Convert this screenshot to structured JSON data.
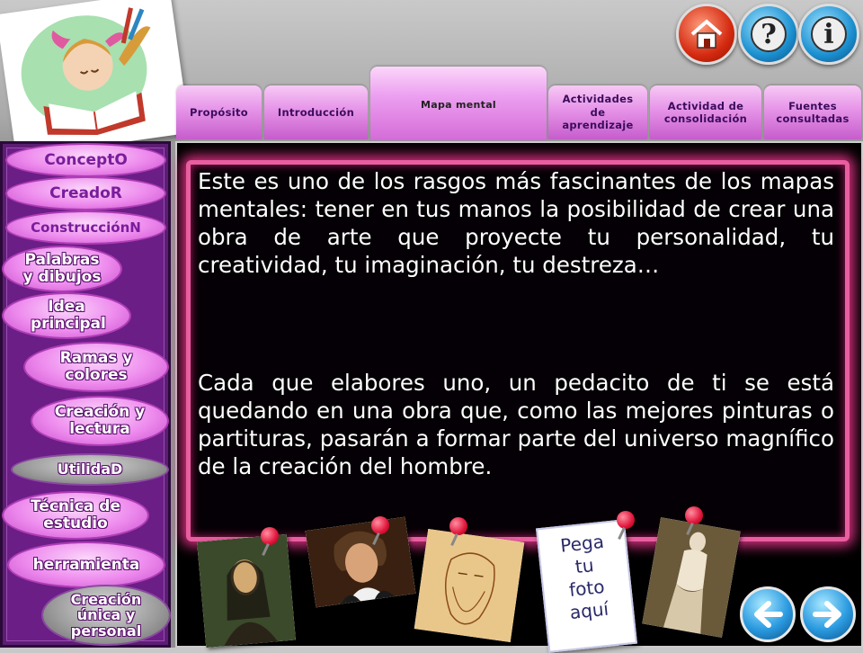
{
  "header": {
    "home_label": "home",
    "help_glyph": "?",
    "info_glyph": "i"
  },
  "tabs": [
    {
      "label": "Propósito"
    },
    {
      "label": "Introducción"
    },
    {
      "label": "Mapa mental",
      "active": true
    },
    {
      "label": "Actividades de aprendizaje"
    },
    {
      "label": "Actividad de consolidación"
    },
    {
      "label": "Fuentes consultadas"
    }
  ],
  "sidebar": {
    "items": [
      {
        "label": "ConceptO",
        "kind": "section"
      },
      {
        "label": "CreadoR",
        "kind": "section"
      },
      {
        "label": "ConstrucciónN",
        "kind": "section"
      },
      {
        "label": "Palabras y dibujos",
        "kind": "pink"
      },
      {
        "label": "Idea principal",
        "kind": "pink"
      },
      {
        "label": "Ramas y colores",
        "kind": "pink"
      },
      {
        "label": "Creación y lectura",
        "kind": "pink"
      },
      {
        "label": "UtilidaD",
        "kind": "gray"
      },
      {
        "label": "Técnica de estudio",
        "kind": "pink"
      },
      {
        "label": "herramienta",
        "kind": "pink"
      },
      {
        "label": "Creación única y personal",
        "kind": "gray"
      }
    ]
  },
  "content": {
    "paragraph1": "Este es uno de los rasgos más fascinantes de los mapas mentales: tener en tus manos la posibilidad de crear una obra de arte que proyecte tu personalidad, tu creatividad, tu imaginación, tu destreza…",
    "paragraph2": "Cada que elabores uno, un pedacito de ti se está quedando en una obra que, como las mejores pinturas o partituras, pasarán a formar parte del universo magnífico de la creación del hombre."
  },
  "photo_frame": {
    "lines": [
      "Pega",
      "tu",
      "foto",
      "aquí"
    ]
  },
  "colors": {
    "accent_pink": "#e85ea0",
    "sidebar_purple": "#6b1e86",
    "tab_pink": "#e693e8"
  },
  "icons": {
    "home": "home-icon",
    "help": "question-icon",
    "info": "info-icon",
    "prev": "arrow-left-icon",
    "next": "arrow-right-icon"
  }
}
